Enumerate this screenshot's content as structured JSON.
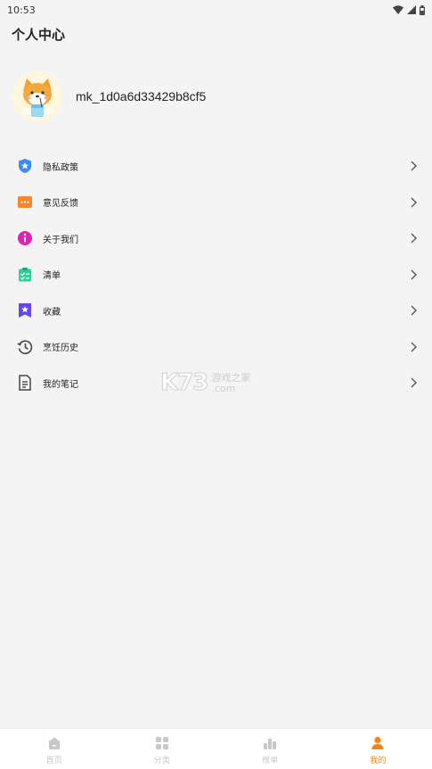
{
  "status_bar": {
    "time": "10:53"
  },
  "header": {
    "title": "个人中心"
  },
  "profile": {
    "username": "mk_1d0a6d33429b8cf5"
  },
  "menu": {
    "items": [
      {
        "label": "隐私政策",
        "icon": "shield-star-icon",
        "color": "#3b8df5"
      },
      {
        "label": "意见反馈",
        "icon": "feedback-icon",
        "color": "#f5862e"
      },
      {
        "label": "关于我们",
        "icon": "info-icon",
        "color": "#e51fb6"
      },
      {
        "label": "清单",
        "icon": "checklist-icon",
        "color": "#2fcf95"
      },
      {
        "label": "收藏",
        "icon": "star-bookmark-icon",
        "color": "#6a44e8"
      },
      {
        "label": "烹饪历史",
        "icon": "history-icon",
        "color": "#444444"
      },
      {
        "label": "我的笔记",
        "icon": "note-icon",
        "color": "#444444"
      }
    ]
  },
  "watermark": {
    "logo": "K73",
    "cn": "游戏之家",
    "url": ".com"
  },
  "tabbar": {
    "tabs": [
      {
        "label": "首页",
        "icon": "home-icon",
        "active": false
      },
      {
        "label": "分类",
        "icon": "grid-icon",
        "active": false
      },
      {
        "label": "榜单",
        "icon": "ranking-icon",
        "active": false
      },
      {
        "label": "我的",
        "icon": "user-icon",
        "active": true
      }
    ],
    "active_color": "#f08519",
    "inactive_color": "#c8c8c8"
  }
}
